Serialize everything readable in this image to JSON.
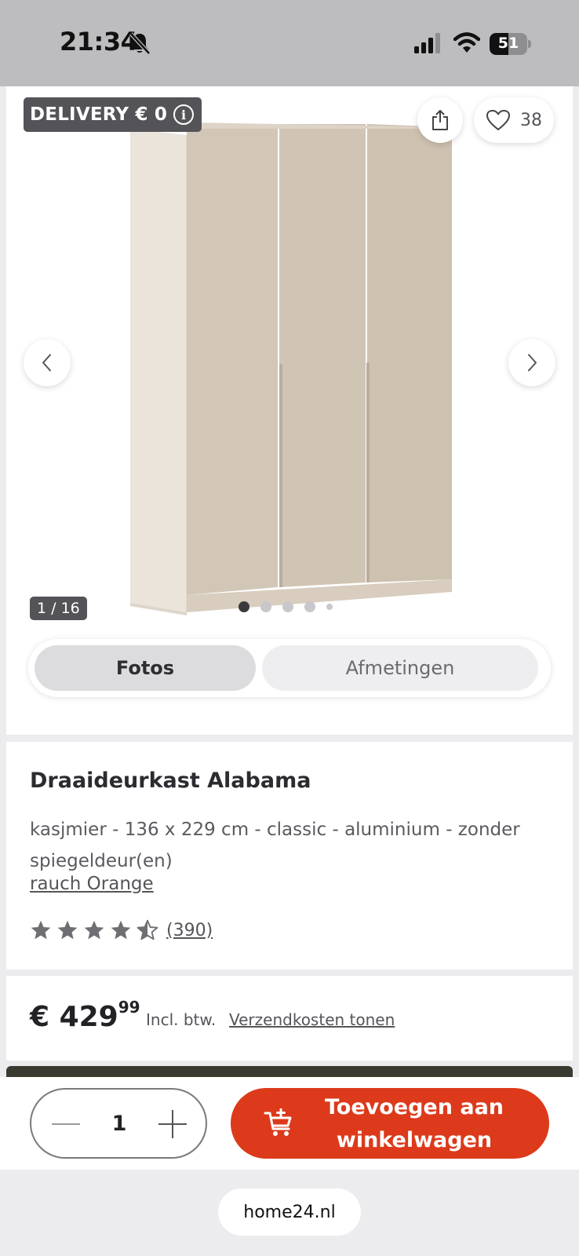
{
  "status_bar": {
    "time": "21:34",
    "battery_level": "51",
    "battery_fraction": 0.51
  },
  "gallery": {
    "delivery_badge": "DELIVERY € 0",
    "wishlist_count": "38",
    "image_counter": "1 / 16",
    "dots_total": 5,
    "dots_active": 1,
    "tabs": [
      {
        "label": "Fotos",
        "active": true
      },
      {
        "label": "Afmetingen",
        "active": false
      }
    ]
  },
  "product": {
    "title": "Draaideurkast Alabama",
    "variant": "kasjmier - 136 x 229 cm - classic - aluminium - zonder spiegeldeur(en)",
    "brand": "rauch Orange",
    "rating_value": 4.5,
    "rating_max": 5,
    "review_count": "(390)"
  },
  "price": {
    "main": "€ 429",
    "cents": "99",
    "vat": "Incl. btw.",
    "shipping_link": "Verzendkosten tonen"
  },
  "purchase": {
    "quantity": "1",
    "add_to_cart_line1": "Toevoegen aan",
    "add_to_cart_line2": "winkelwagen"
  },
  "browser": {
    "url": "home24.nl"
  },
  "colors": {
    "accent": "#dc3a1b",
    "badge_bg": "#545458",
    "status_bar_bg": "#bdbdbf"
  },
  "icons": [
    "bell-slash-icon",
    "signal-icon",
    "wifi-icon",
    "battery-icon",
    "info-icon",
    "share-icon",
    "heart-icon",
    "chevron-left-icon",
    "chevron-right-icon",
    "star-icon",
    "minus-icon",
    "plus-icon",
    "cart-add-icon"
  ]
}
